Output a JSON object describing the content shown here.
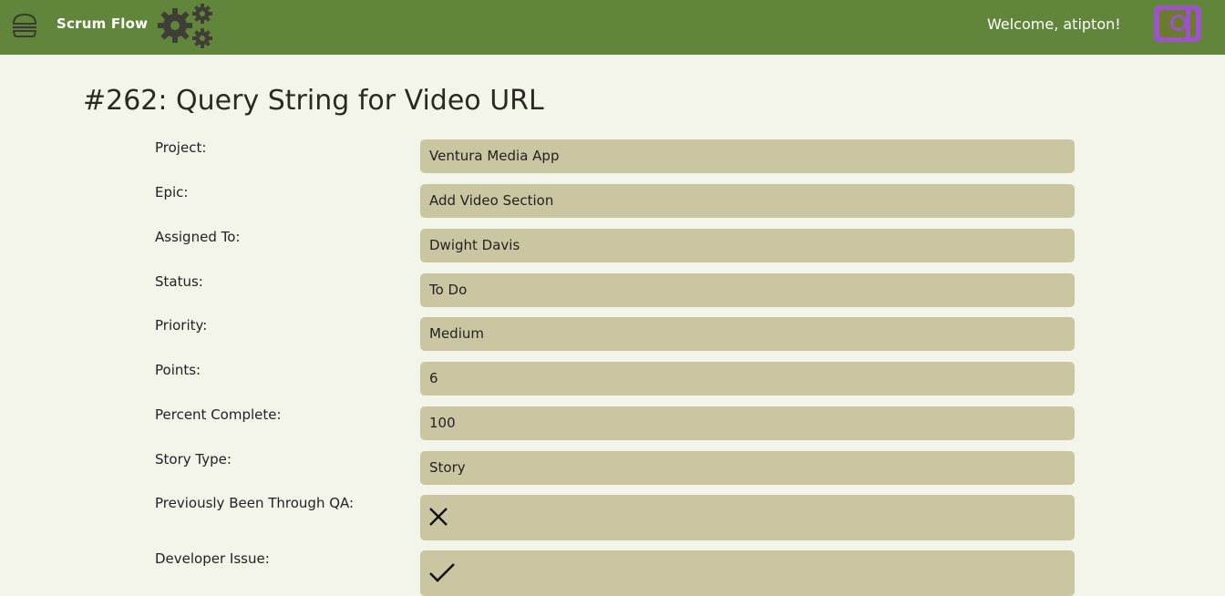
{
  "app": {
    "title": "Scrum Flow",
    "welcome": "Welcome, atipton!",
    "brand_color": "#61853b"
  },
  "story": {
    "heading": "#262: Query String for Video URL"
  },
  "fields": {
    "project": {
      "label": "Project:",
      "value": "Ventura Media App"
    },
    "epic": {
      "label": "Epic:",
      "value": "Add Video Section"
    },
    "assigned_to": {
      "label": "Assigned To:",
      "value": "Dwight Davis"
    },
    "status": {
      "label": "Status:",
      "value": "To Do"
    },
    "priority": {
      "label": "Priority:",
      "value": "Medium"
    },
    "points": {
      "label": "Points:",
      "value": "6"
    },
    "percent_complete": {
      "label": "Percent Complete:",
      "value": "100"
    },
    "story_type": {
      "label": "Story Type:",
      "value": "Story"
    },
    "previously_qa": {
      "label": "Previously Been Through QA:",
      "value": false,
      "icon": "x-icon"
    },
    "developer_issue": {
      "label": "Developer Issue:",
      "value": true,
      "icon": "check-icon"
    }
  },
  "icons": {
    "menu": "hamburger-icon",
    "settings": "gears-icon",
    "avatar": "user-avatar"
  }
}
